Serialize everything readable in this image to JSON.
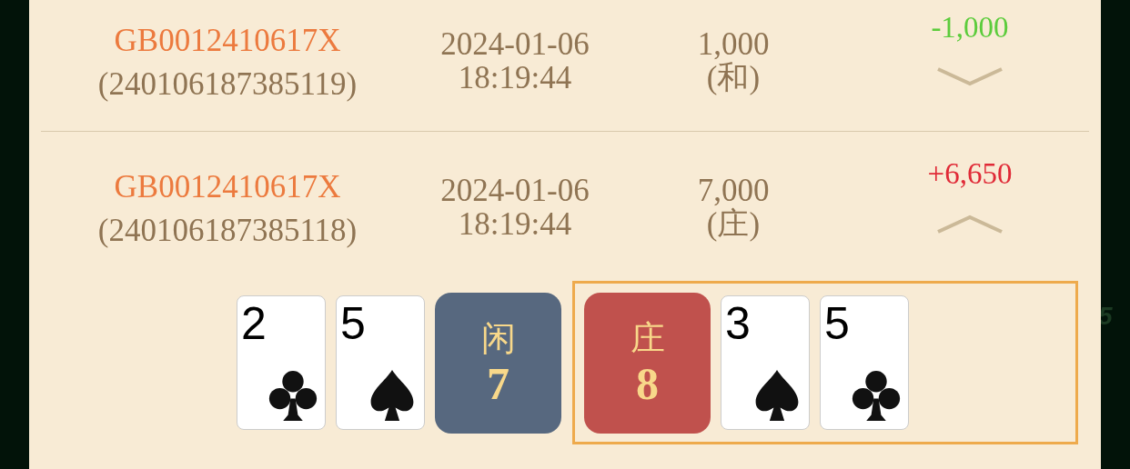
{
  "background_text": "5",
  "records": [
    {
      "table_id": "GB0012410617X",
      "round_id": "(240106187385119)",
      "date": "2024-01-06",
      "time": "18:19:44",
      "amount": "1,000",
      "bet": "(和)",
      "result": "-1,000",
      "kind": "loss",
      "expanded": false
    },
    {
      "table_id": "GB0012410617X",
      "round_id": "(240106187385118)",
      "date": "2024-01-06",
      "time": "18:19:44",
      "amount": "7,000",
      "bet": "(庄)",
      "result": "+6,650",
      "kind": "win",
      "expanded": true,
      "hands": [
        {
          "kind": "player",
          "label": "闲",
          "score": "7",
          "winner": false,
          "cards": [
            {
              "rank": "2",
              "kind": "clubs"
            },
            {
              "rank": "5",
              "kind": "spades"
            }
          ]
        },
        {
          "kind": "banker",
          "label": "庄",
          "score": "8",
          "winner": true,
          "cards": [
            {
              "rank": "3",
              "kind": "spades"
            },
            {
              "rank": "5",
              "kind": "clubs"
            }
          ]
        }
      ]
    }
  ]
}
